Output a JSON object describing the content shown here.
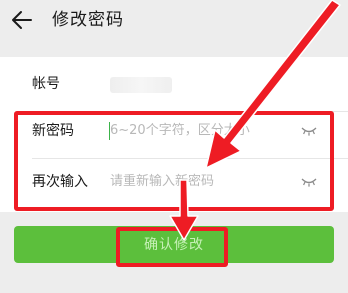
{
  "header": {
    "title": "修改密码",
    "back_icon": "arrow-left-icon"
  },
  "form": {
    "account": {
      "label": "帐号",
      "value_hidden": true
    },
    "new_password": {
      "label": "新密码",
      "placeholder": "6~20个字符，区分大小",
      "toggle_icon": "eye-closed-icon"
    },
    "confirm_password": {
      "label": "再次输入",
      "placeholder": "请重新输入新密码",
      "toggle_icon": "eye-closed-icon"
    }
  },
  "actions": {
    "confirm_label": "确认修改"
  },
  "annotations": {
    "highlight_color": "#ee1c24"
  },
  "colors": {
    "button": "#5cbf3c",
    "button_text": "#c6f0b6",
    "background": "#ededed",
    "caret": "#3cb34a"
  }
}
